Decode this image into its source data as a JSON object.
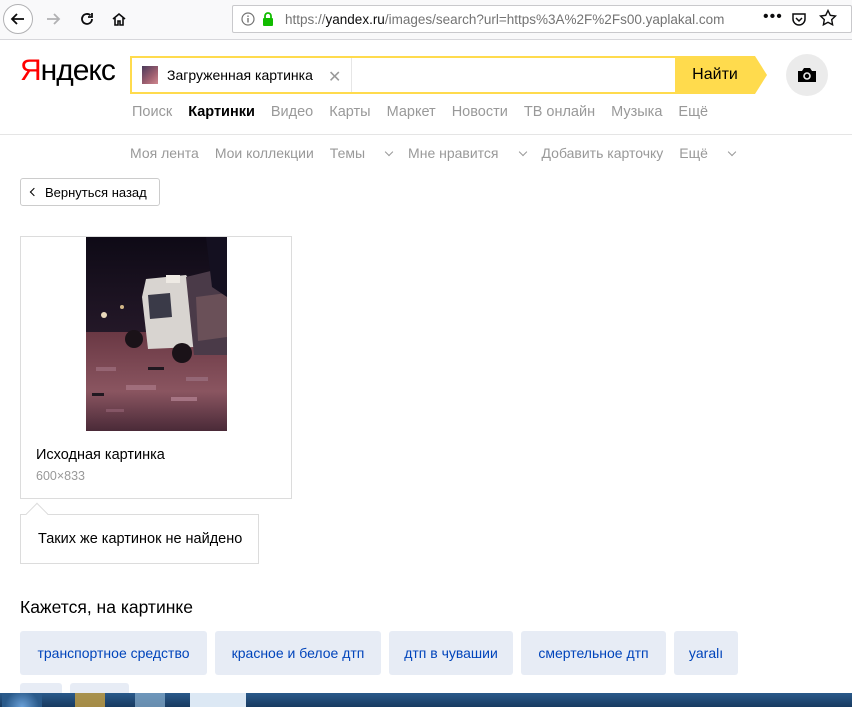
{
  "browser": {
    "url_scheme": "https://",
    "url_host": "yandex.ru",
    "url_rest": "/images/search?url=https%3A%2F%2Fs00.yaplakal.com",
    "more_label": "•••"
  },
  "header": {
    "logo_first": "Я",
    "logo_rest": "ндекс",
    "search_chip_label": "Загруженная картинка",
    "search_button_label": "Найти"
  },
  "services": [
    "Поиск",
    "Картинки",
    "Видео",
    "Карты",
    "Маркет",
    "Новости",
    "ТВ онлайн",
    "Музыка",
    "Ещё"
  ],
  "active_service": "Картинки",
  "subnav": {
    "my_feed": "Моя лента",
    "my_collections": "Мои коллекции",
    "themes": "Темы",
    "likes": "Мне нравится",
    "add_card": "Добавить карточку",
    "more": "Ещё"
  },
  "back_button_label": "Вернуться назад",
  "source_card": {
    "title": "Исходная картинка",
    "size": "600×833"
  },
  "not_found_text": "Таких же картинок не найдено",
  "tags_heading": "Кажется, на картинке",
  "tags": [
    "транспортное средство",
    "красное и белое дтп",
    "дтп в чувашии",
    "смертельное дтп",
    "yaralı"
  ],
  "colors": {
    "accent_yellow": "#ffdb4d",
    "logo_red": "#ff0000",
    "tag_bg": "#e7ecf5",
    "tag_text": "#0044bb"
  }
}
